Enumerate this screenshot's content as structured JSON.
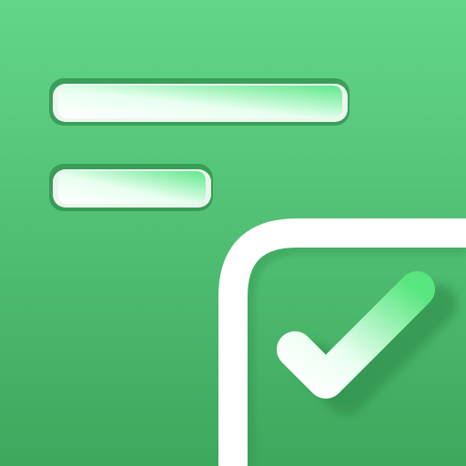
{
  "icon": {
    "name": "checklist-app-icon",
    "shapes": [
      "text-line",
      "text-line",
      "rounded-corner-frame",
      "checkmark"
    ],
    "colors": {
      "background_top": "#63d68a",
      "background_bottom": "#3ea85d",
      "line_fill_light": "#ffffff",
      "line_fill_green": "#5fe88a",
      "line_inset_shadow": "#2f8f4c",
      "frame": "#ffffff",
      "check_light": "#ffffff",
      "check_green": "#58e67f",
      "check_shadow": "#2f8a49"
    }
  }
}
